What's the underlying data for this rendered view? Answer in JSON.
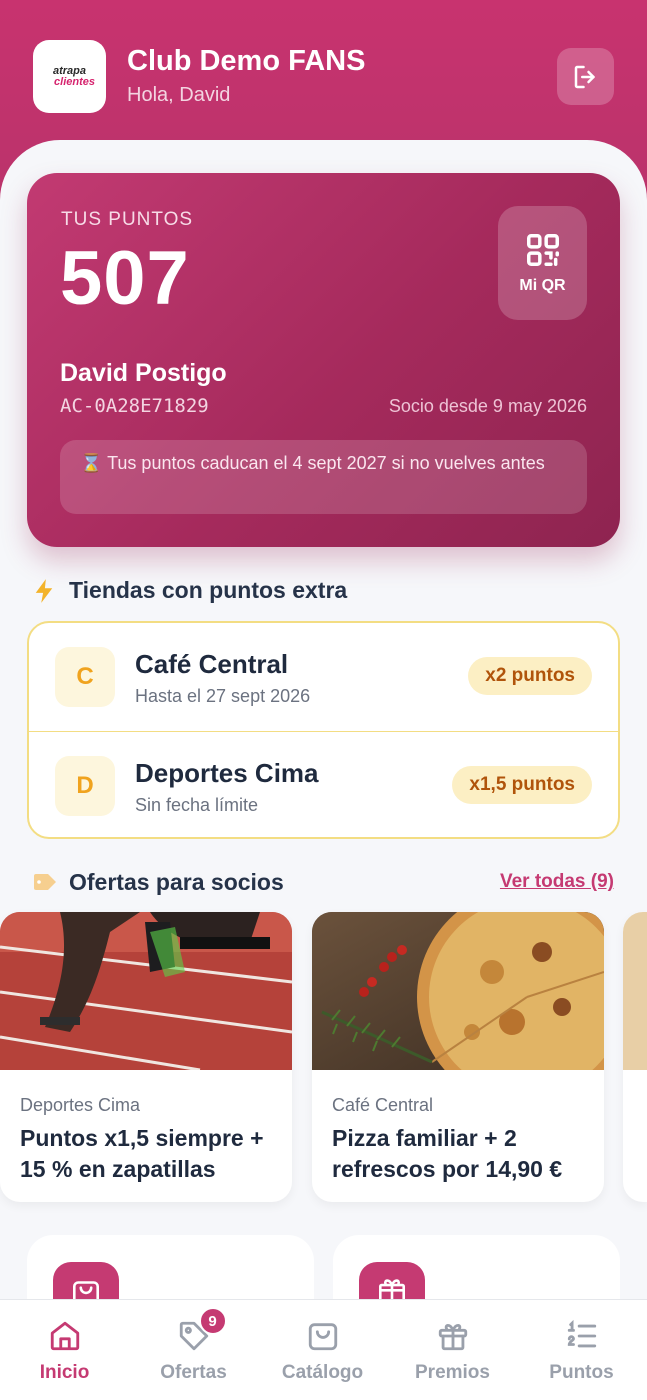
{
  "header": {
    "logo_line1": "atrapa",
    "logo_line2": "clientes",
    "title": "Club Demo FANS",
    "greeting": "Hola, David"
  },
  "points_card": {
    "label": "TUS PUNTOS",
    "points": "507",
    "qr_label": "Mi QR",
    "member_name": "David Postigo",
    "member_id": "AC-0A28E71829",
    "member_since": "Socio desde 9 may 2026",
    "expiry_warning": "⌛ Tus puntos caducan el 4 sept 2027 si no vuelves antes"
  },
  "stores_section": {
    "title": "Tiendas con puntos extra",
    "stores": [
      {
        "initial": "C",
        "name": "Café Central",
        "subtitle": "Hasta el 27 sept 2026",
        "badge": "x2 puntos"
      },
      {
        "initial": "D",
        "name": "Deportes Cima",
        "subtitle": "Sin fecha límite",
        "badge": "x1,5 puntos"
      }
    ]
  },
  "offers_section": {
    "title": "Ofertas para socios",
    "see_all": "Ver todas (9)",
    "offers": [
      {
        "store": "Deportes Cima",
        "title": "Puntos x1,5 siempre + 15 % en zapatillas",
        "image": "sprinter-start-photo"
      },
      {
        "store": "Café Central",
        "title": "Pizza familiar + 2 refrescos por 14,90 €",
        "image": "pizza-photo"
      }
    ]
  },
  "shortcuts": [
    {
      "icon": "shopping-bag-icon"
    },
    {
      "icon": "gift-icon"
    }
  ],
  "bottom_nav": {
    "items": [
      {
        "label": "Inicio",
        "icon": "home-icon",
        "active": true
      },
      {
        "label": "Ofertas",
        "icon": "tag-icon",
        "badge": "9"
      },
      {
        "label": "Catálogo",
        "icon": "shopping-bag-icon"
      },
      {
        "label": "Premios",
        "icon": "gift-icon"
      },
      {
        "label": "Puntos",
        "icon": "list-numbered-icon"
      }
    ]
  },
  "colors": {
    "brand": "#c53a72",
    "header_bg": "#c8336f",
    "highlight_border": "#f3dd83",
    "badge_bg": "#fcefc4",
    "badge_text": "#b0540b"
  }
}
